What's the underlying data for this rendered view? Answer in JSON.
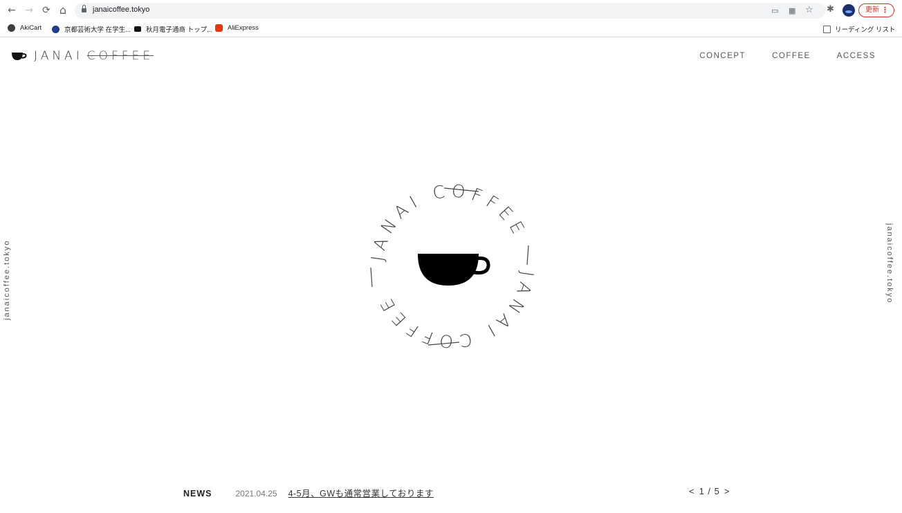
{
  "browser": {
    "back_icon": "←",
    "forward_icon": "→",
    "reload_icon": "⟳",
    "home_icon": "⌂",
    "url": "janaicoffee.tokyo",
    "update_label": "更新",
    "menu_icon": "⋮",
    "star_icon": "☆",
    "extensions_icon": "✱",
    "cast_icon": "▭",
    "qr_icon": "▦"
  },
  "bookmarks": {
    "items": [
      {
        "label": "AkiCart"
      },
      {
        "label": "京都芸術大学 在学生..."
      },
      {
        "label": "秋月電子通商 トップ..."
      },
      {
        "label": "AliExpress"
      }
    ],
    "reading_list": "リーディング リスト"
  },
  "site": {
    "logo": {
      "janai": "JANAI",
      "coffee": "COFFEE"
    },
    "nav": [
      {
        "label": "CONCEPT"
      },
      {
        "label": "COFFEE"
      },
      {
        "label": "ACCESS"
      }
    ],
    "side_text": "janaicoffee.tokyo",
    "emblem": {
      "arc_top": "JANAI COFFEE",
      "arc_bottom": "JANAI COFFEE"
    },
    "news": {
      "label": "NEWS",
      "date": "2021.04.25",
      "title": "4-5月、GWも通常営業しております",
      "prev": "<",
      "page": "1 / 5",
      "next": ">"
    }
  },
  "colors": {
    "accent_red": "#d93025",
    "text": "#333333"
  }
}
